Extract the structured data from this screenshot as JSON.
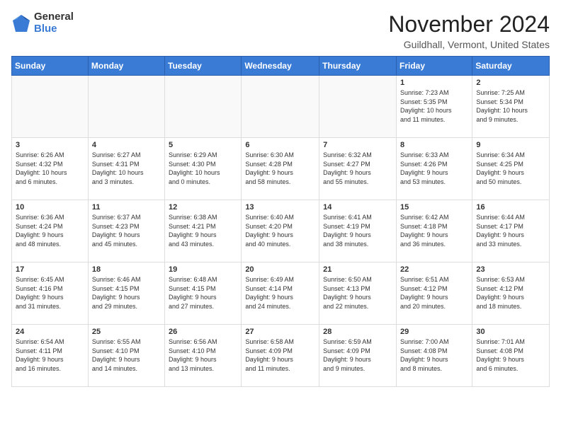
{
  "header": {
    "logo_general": "General",
    "logo_blue": "Blue",
    "month_title": "November 2024",
    "location": "Guildhall, Vermont, United States"
  },
  "weekdays": [
    "Sunday",
    "Monday",
    "Tuesday",
    "Wednesday",
    "Thursday",
    "Friday",
    "Saturday"
  ],
  "weeks": [
    [
      {
        "day": "",
        "info": ""
      },
      {
        "day": "",
        "info": ""
      },
      {
        "day": "",
        "info": ""
      },
      {
        "day": "",
        "info": ""
      },
      {
        "day": "",
        "info": ""
      },
      {
        "day": "1",
        "info": "Sunrise: 7:23 AM\nSunset: 5:35 PM\nDaylight: 10 hours\nand 11 minutes."
      },
      {
        "day": "2",
        "info": "Sunrise: 7:25 AM\nSunset: 5:34 PM\nDaylight: 10 hours\nand 9 minutes."
      }
    ],
    [
      {
        "day": "3",
        "info": "Sunrise: 6:26 AM\nSunset: 4:32 PM\nDaylight: 10 hours\nand 6 minutes."
      },
      {
        "day": "4",
        "info": "Sunrise: 6:27 AM\nSunset: 4:31 PM\nDaylight: 10 hours\nand 3 minutes."
      },
      {
        "day": "5",
        "info": "Sunrise: 6:29 AM\nSunset: 4:30 PM\nDaylight: 10 hours\nand 0 minutes."
      },
      {
        "day": "6",
        "info": "Sunrise: 6:30 AM\nSunset: 4:28 PM\nDaylight: 9 hours\nand 58 minutes."
      },
      {
        "day": "7",
        "info": "Sunrise: 6:32 AM\nSunset: 4:27 PM\nDaylight: 9 hours\nand 55 minutes."
      },
      {
        "day": "8",
        "info": "Sunrise: 6:33 AM\nSunset: 4:26 PM\nDaylight: 9 hours\nand 53 minutes."
      },
      {
        "day": "9",
        "info": "Sunrise: 6:34 AM\nSunset: 4:25 PM\nDaylight: 9 hours\nand 50 minutes."
      }
    ],
    [
      {
        "day": "10",
        "info": "Sunrise: 6:36 AM\nSunset: 4:24 PM\nDaylight: 9 hours\nand 48 minutes."
      },
      {
        "day": "11",
        "info": "Sunrise: 6:37 AM\nSunset: 4:23 PM\nDaylight: 9 hours\nand 45 minutes."
      },
      {
        "day": "12",
        "info": "Sunrise: 6:38 AM\nSunset: 4:21 PM\nDaylight: 9 hours\nand 43 minutes."
      },
      {
        "day": "13",
        "info": "Sunrise: 6:40 AM\nSunset: 4:20 PM\nDaylight: 9 hours\nand 40 minutes."
      },
      {
        "day": "14",
        "info": "Sunrise: 6:41 AM\nSunset: 4:19 PM\nDaylight: 9 hours\nand 38 minutes."
      },
      {
        "day": "15",
        "info": "Sunrise: 6:42 AM\nSunset: 4:18 PM\nDaylight: 9 hours\nand 36 minutes."
      },
      {
        "day": "16",
        "info": "Sunrise: 6:44 AM\nSunset: 4:17 PM\nDaylight: 9 hours\nand 33 minutes."
      }
    ],
    [
      {
        "day": "17",
        "info": "Sunrise: 6:45 AM\nSunset: 4:16 PM\nDaylight: 9 hours\nand 31 minutes."
      },
      {
        "day": "18",
        "info": "Sunrise: 6:46 AM\nSunset: 4:15 PM\nDaylight: 9 hours\nand 29 minutes."
      },
      {
        "day": "19",
        "info": "Sunrise: 6:48 AM\nSunset: 4:15 PM\nDaylight: 9 hours\nand 27 minutes."
      },
      {
        "day": "20",
        "info": "Sunrise: 6:49 AM\nSunset: 4:14 PM\nDaylight: 9 hours\nand 24 minutes."
      },
      {
        "day": "21",
        "info": "Sunrise: 6:50 AM\nSunset: 4:13 PM\nDaylight: 9 hours\nand 22 minutes."
      },
      {
        "day": "22",
        "info": "Sunrise: 6:51 AM\nSunset: 4:12 PM\nDaylight: 9 hours\nand 20 minutes."
      },
      {
        "day": "23",
        "info": "Sunrise: 6:53 AM\nSunset: 4:12 PM\nDaylight: 9 hours\nand 18 minutes."
      }
    ],
    [
      {
        "day": "24",
        "info": "Sunrise: 6:54 AM\nSunset: 4:11 PM\nDaylight: 9 hours\nand 16 minutes."
      },
      {
        "day": "25",
        "info": "Sunrise: 6:55 AM\nSunset: 4:10 PM\nDaylight: 9 hours\nand 14 minutes."
      },
      {
        "day": "26",
        "info": "Sunrise: 6:56 AM\nSunset: 4:10 PM\nDaylight: 9 hours\nand 13 minutes."
      },
      {
        "day": "27",
        "info": "Sunrise: 6:58 AM\nSunset: 4:09 PM\nDaylight: 9 hours\nand 11 minutes."
      },
      {
        "day": "28",
        "info": "Sunrise: 6:59 AM\nSunset: 4:09 PM\nDaylight: 9 hours\nand 9 minutes."
      },
      {
        "day": "29",
        "info": "Sunrise: 7:00 AM\nSunset: 4:08 PM\nDaylight: 9 hours\nand 8 minutes."
      },
      {
        "day": "30",
        "info": "Sunrise: 7:01 AM\nSunset: 4:08 PM\nDaylight: 9 hours\nand 6 minutes."
      }
    ]
  ]
}
